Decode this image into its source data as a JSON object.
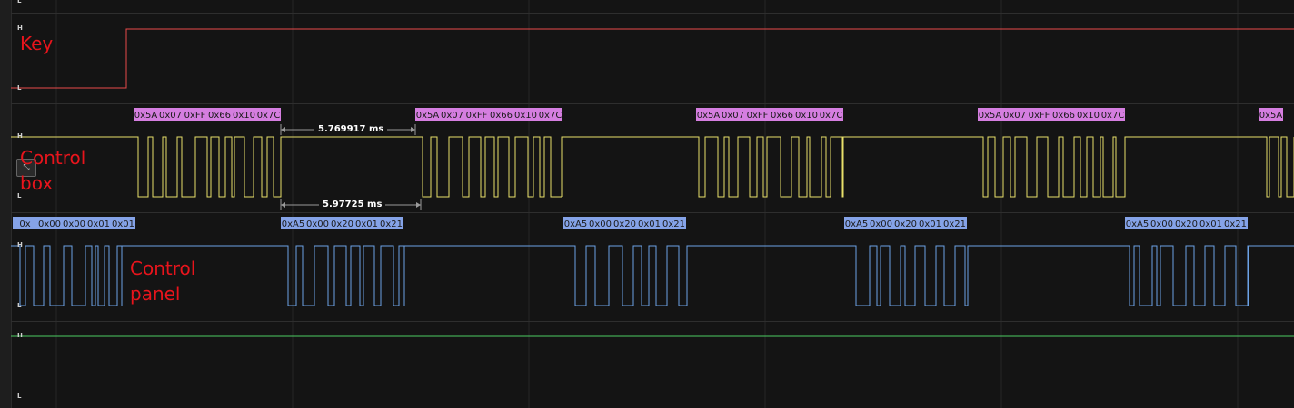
{
  "channels": [
    {
      "id": "key",
      "label": "Key",
      "color": "#e84a4a",
      "high": "H",
      "low": "L"
    },
    {
      "id": "control-box",
      "label": "Control box",
      "color": "#e8e06a",
      "high": "H",
      "low": "L"
    },
    {
      "id": "control-panel",
      "label": "Control panel",
      "color": "#6ba2e6",
      "high": "H",
      "low": "L"
    },
    {
      "id": "channel-4",
      "label": "",
      "color": "#4ccd62",
      "high": "H",
      "low": "L"
    }
  ],
  "top_level_marker": "L",
  "control_box_bytes": [
    "0x5A",
    "0x07",
    "0xFF",
    "0x66",
    "0x10",
    "0x7C"
  ],
  "control_panel_bytes": [
    "0xA5",
    "0x00",
    "0x20",
    "0x01",
    "0x21"
  ],
  "control_panel_first_frame": [
    "0x",
    "0x00",
    "0x00",
    "0x01",
    "0x01"
  ],
  "truncated_box_frame": [
    "0x5A"
  ],
  "measurements": {
    "upper": "5.769917 ms",
    "lower": "5.97725 ms"
  },
  "icon": "waveform-tool-icon"
}
